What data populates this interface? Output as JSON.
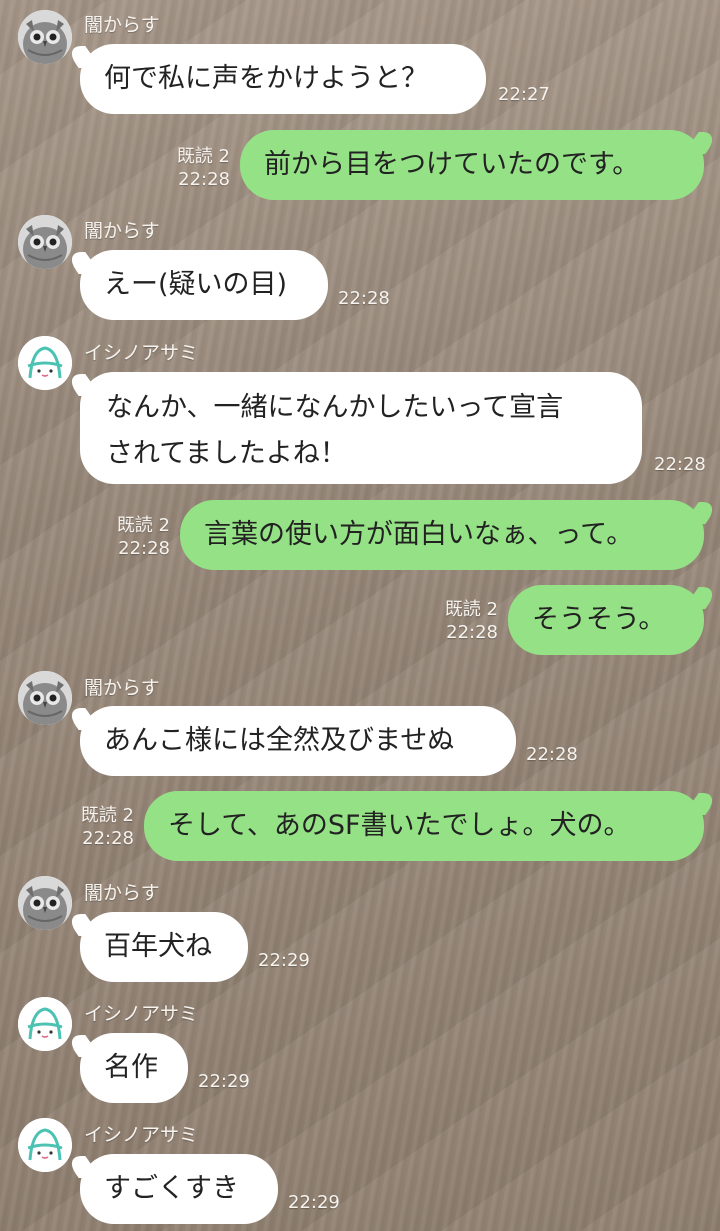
{
  "users": {
    "crow": {
      "name": "闇からす"
    },
    "asami": {
      "name": "イシノアサミ"
    }
  },
  "messages": [
    {
      "from": "crow",
      "text": "何で私に声をかけようと？",
      "time": "22:27"
    },
    {
      "from": "me",
      "text": "前から目をつけていたのです。",
      "read": "既読 2",
      "time": "22:28"
    },
    {
      "from": "crow",
      "text": "えー(疑いの目)",
      "time": "22:28"
    },
    {
      "from": "asami",
      "lines": [
        "なんか、一緒になんかしたいって宣言",
        "されてましたよね！"
      ],
      "time": "22:28"
    },
    {
      "from": "me",
      "text": "言葉の使い方が面白いなぁ、って。",
      "read": "既読 2",
      "time": "22:28"
    },
    {
      "from": "me",
      "text": "そうそう。",
      "read": "既読 2",
      "time": "22:28"
    },
    {
      "from": "crow",
      "text": "あんこ様には全然及びませぬ",
      "time": "22:28"
    },
    {
      "from": "me",
      "text": "そして、あのSF書いたでしょ。犬の。",
      "read": "既読 2",
      "time": "22:28"
    },
    {
      "from": "crow",
      "text": "百年犬ね",
      "time": "22:29"
    },
    {
      "from": "asami",
      "text": "名作",
      "time": "22:29"
    },
    {
      "from": "asami",
      "text": "すごくすき",
      "time": "22:29"
    }
  ],
  "colors": {
    "outgoing_bubble": "#95e286",
    "incoming_bubble": "#ffffff"
  },
  "icons": {
    "crow_avatar": "owl-avatar-icon",
    "asami_avatar": "sprout-face-avatar-icon"
  }
}
